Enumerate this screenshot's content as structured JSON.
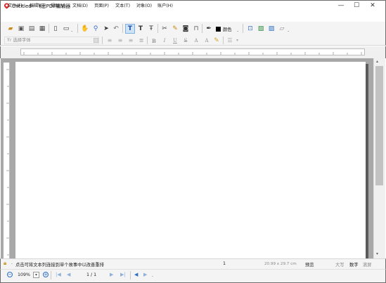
{
  "window": {
    "title": "Untitled - 飞思PDF编辑器",
    "controls": {
      "minimize": "—",
      "maximize": "☐",
      "close": "✕"
    }
  },
  "menu": [
    "文件(F)",
    "编辑(E)",
    "视图(V)",
    "文档(D)",
    "页面(P)",
    "文本(T)",
    "对象(O)",
    "账户(H)"
  ],
  "toolbar": {
    "color_label": "颜色",
    "icons": [
      "open-icon",
      "save-icon",
      "save-as-icon",
      "print-icon",
      "page-icon",
      "page-view-icon",
      "hand-icon",
      "zoom-icon",
      "select-arrow-icon",
      "undo-icon",
      "text-tool-icon",
      "text-edit-icon",
      "text-insert-icon",
      "cut-icon",
      "pen-icon",
      "camera-icon",
      "link-icon",
      "eyedropper-icon",
      "color-swatch-icon",
      "stamp-icon",
      "bookmark-icon",
      "bookmark-add-icon",
      "page-add-icon"
    ]
  },
  "format": {
    "font_placeholder": "选择字体",
    "bold": "B",
    "italic": "I",
    "underline": "U",
    "strike": "S",
    "superscript": "A",
    "subscript": "A"
  },
  "status": {
    "message": "点击可将文本列连接到单个故事中以改善重排",
    "page_number": "1",
    "page_size": "20.99 x 29.7 cm",
    "preview": "预览",
    "caps": "大写",
    "num": "数字",
    "scroll": "滚屏"
  },
  "navigation": {
    "zoom": "109%",
    "page_indicator": "1 / 1"
  }
}
